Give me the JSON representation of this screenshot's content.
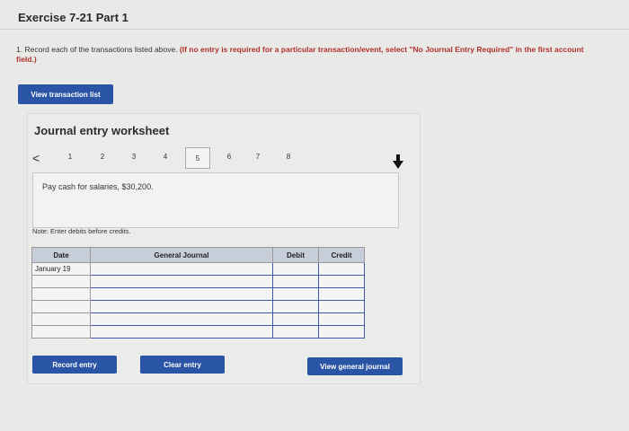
{
  "page": {
    "title": "Exercise 7-21 Part 1",
    "instruction_lead": "1. Record each of the transactions listed above. ",
    "instruction_red": "(If no entry is required for a particular transaction/event, select \"No Journal Entry Required\" in the first account field.)"
  },
  "buttons": {
    "view_transaction_list": "View transaction list",
    "record_entry": "Record entry",
    "clear_entry": "Clear entry",
    "view_general_journal": "View general journal"
  },
  "worksheet": {
    "title": "Journal entry worksheet",
    "pages": [
      "1",
      "2",
      "3",
      "4",
      "5",
      "6",
      "7",
      "8"
    ],
    "active_page": "5",
    "prev_arrow": "<",
    "description": "Pay cash for salaries, $30,200.",
    "note": "Note: Enter debits before credits."
  },
  "journal": {
    "headers": {
      "date": "Date",
      "account": "General Journal",
      "debit": "Debit",
      "credit": "Credit"
    },
    "rows": [
      {
        "date": "January 19",
        "account": "",
        "debit": "",
        "credit": ""
      },
      {
        "date": "",
        "account": "",
        "debit": "",
        "credit": ""
      },
      {
        "date": "",
        "account": "",
        "debit": "",
        "credit": ""
      },
      {
        "date": "",
        "account": "",
        "debit": "",
        "credit": ""
      },
      {
        "date": "",
        "account": "",
        "debit": "",
        "credit": ""
      },
      {
        "date": "",
        "account": "",
        "debit": "",
        "credit": ""
      }
    ]
  },
  "colors": {
    "accent": "#2a54a5",
    "instruction_red": "#b0312b",
    "header_bg": "#c7ced9"
  },
  "icons": {
    "cursor": "mouse-cursor-icon"
  }
}
